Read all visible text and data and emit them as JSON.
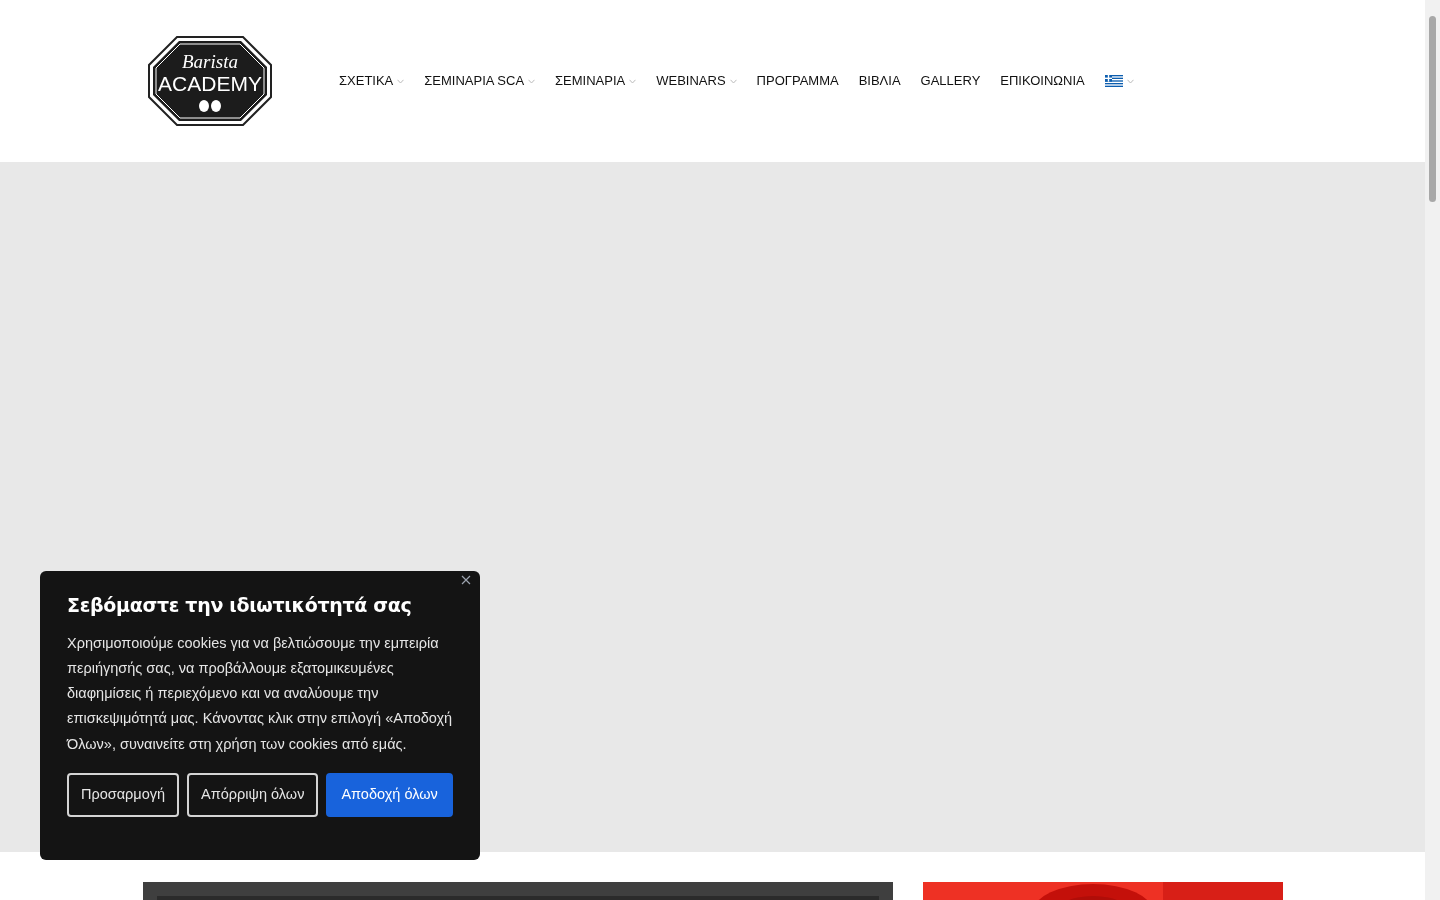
{
  "logo": {
    "script": "Barista",
    "wordmark": "ACADEMY"
  },
  "nav": [
    {
      "kind": "text",
      "label": "ΣΧΕΤΙΚΑ",
      "dropdown": true
    },
    {
      "kind": "text",
      "label": "ΣΕΜΙΝΑΡΙΑ SCA",
      "dropdown": true
    },
    {
      "kind": "text",
      "label": "ΣΕΜΙΝΑΡΙΑ",
      "dropdown": true
    },
    {
      "kind": "text",
      "label": "WEBINARS",
      "dropdown": true
    },
    {
      "kind": "text",
      "label": "ΠΡΟΓΡΑΜΜΑ",
      "dropdown": false
    },
    {
      "kind": "text",
      "label": "ΒΙΒΛΙΑ",
      "dropdown": false
    },
    {
      "kind": "text",
      "label": "GALLERY",
      "dropdown": false
    },
    {
      "kind": "text",
      "label": "ΕΠΙΚΟΙΝΩΝΙΑ",
      "dropdown": false
    },
    {
      "kind": "flag",
      "dropdown": true
    }
  ],
  "cookie_banner": {
    "title": "Σεβόμαστε την ιδιωτικότητά σας",
    "text": "Χρησιμοποιούμε cookies για να βελτιώσουμε την εμπειρία περιήγησής σας, να προβάλλουμε εξατομικευμένες διαφημίσεις ή περιεχόμενο και να αναλύουμε την επισκεψιμότητά μας. Κάνοντας κλικ στην επιλογή «Αποδοχή Όλων», συναινείτε στη χρήση των cookies από εμάς.",
    "buttons": [
      {
        "kind": "outline",
        "label": "Προσαρμογή"
      },
      {
        "kind": "outline",
        "label": "Απόρριψη όλων"
      },
      {
        "kind": "primary",
        "label": "Αποδοχή όλων"
      }
    ]
  }
}
